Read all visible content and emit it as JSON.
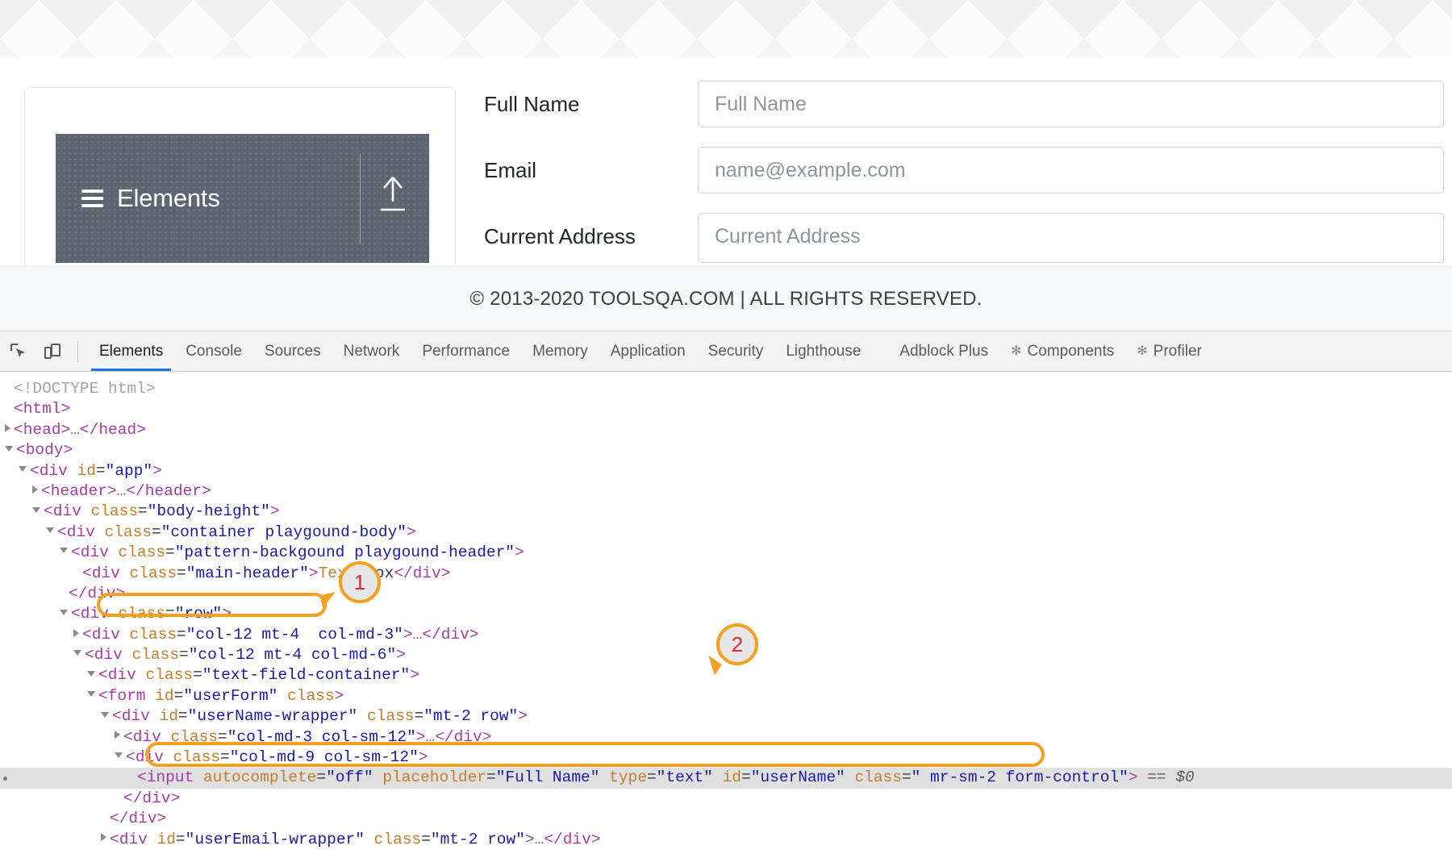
{
  "webpage": {
    "accordion": {
      "title": "Elements",
      "menu_icon": "hamburger-icon",
      "collapse_icon": "arrow-up-icon"
    },
    "form": {
      "fields": [
        {
          "label": "Full Name",
          "placeholder": "Full Name"
        },
        {
          "label": "Email",
          "placeholder": "name@example.com"
        },
        {
          "label": "Current Address",
          "placeholder": "Current Address"
        }
      ]
    },
    "footer": {
      "copyright": "© 2013-2020 TOOLSQA.COM | ALL RIGHTS RESERVED."
    }
  },
  "devtools": {
    "toolbar": {
      "inspect_icon": "inspect-element-icon",
      "device_icon": "device-toolbar-icon"
    },
    "tabs": [
      {
        "label": "Elements",
        "active": true,
        "icon": ""
      },
      {
        "label": "Console",
        "active": false,
        "icon": ""
      },
      {
        "label": "Sources",
        "active": false,
        "icon": ""
      },
      {
        "label": "Network",
        "active": false,
        "icon": ""
      },
      {
        "label": "Performance",
        "active": false,
        "icon": ""
      },
      {
        "label": "Memory",
        "active": false,
        "icon": ""
      },
      {
        "label": "Application",
        "active": false,
        "icon": ""
      },
      {
        "label": "Security",
        "active": false,
        "icon": ""
      },
      {
        "label": "Lighthouse",
        "active": false,
        "icon": ""
      },
      {
        "label": "Adblock Plus",
        "active": false,
        "icon": ""
      },
      {
        "label": "Components",
        "active": false,
        "icon": "react-icon"
      },
      {
        "label": "Profiler",
        "active": false,
        "icon": "react-icon"
      }
    ],
    "dom_lines": [
      {
        "indent": 0,
        "twisty": "none",
        "text": "<!DOCTYPE html>",
        "kind": "doctype"
      },
      {
        "indent": 0,
        "twisty": "none",
        "text": "<html>",
        "kind": "tag"
      },
      {
        "indent": 0,
        "twisty": "closed",
        "text": "<head>…</head>",
        "kind": "tag"
      },
      {
        "indent": 0,
        "twisty": "open",
        "text": "<body>",
        "kind": "tag"
      },
      {
        "indent": 1,
        "twisty": "open",
        "text": "<div id=\"app\">",
        "kind": "mixed"
      },
      {
        "indent": 2,
        "twisty": "closed",
        "text": "<header>…</header>",
        "kind": "tag"
      },
      {
        "indent": 2,
        "twisty": "open",
        "text": "<div class=\"body-height\">",
        "kind": "mixed"
      },
      {
        "indent": 3,
        "twisty": "open",
        "text": "<div class=\"container playgound-body\">",
        "kind": "mixed"
      },
      {
        "indent": 4,
        "twisty": "open",
        "text": "<div class=\"pattern-backgound playgound-header\">",
        "kind": "mixed"
      },
      {
        "indent": 5,
        "twisty": "none",
        "text": "<div class=\"main-header\">Text Box</div>",
        "kind": "mixed"
      },
      {
        "indent": 4,
        "twisty": "none",
        "text": "</div>",
        "kind": "tag"
      },
      {
        "indent": 4,
        "twisty": "open",
        "text": "<div class=\"row\">",
        "kind": "mixed"
      },
      {
        "indent": 5,
        "twisty": "closed",
        "text": "<div class=\"col-12 mt-4  col-md-3\">…</div>",
        "kind": "mixed"
      },
      {
        "indent": 5,
        "twisty": "open",
        "text": "<div class=\"col-12 mt-4 col-md-6\">",
        "kind": "mixed"
      },
      {
        "indent": 6,
        "twisty": "open",
        "text": "<div class=\"text-field-container\">",
        "kind": "mixed"
      },
      {
        "indent": 6,
        "twisty": "open",
        "text": "<form id=\"userForm\" class>",
        "kind": "mixed",
        "highlight": 1
      },
      {
        "indent": 7,
        "twisty": "open",
        "text": "<div id=\"userName-wrapper\" class=\"mt-2 row\">",
        "kind": "mixed"
      },
      {
        "indent": 8,
        "twisty": "closed",
        "text": "<div class=\"col-md-3 col-sm-12\">…</div>",
        "kind": "mixed"
      },
      {
        "indent": 8,
        "twisty": "open",
        "text": "<div class=\"col-md-9 col-sm-12\">",
        "kind": "mixed"
      },
      {
        "indent": 9,
        "twisty": "none",
        "text": "<input autocomplete=\"off\" placeholder=\"Full Name\" type=\"text\" id=\"userName\" class=\" mr-sm-2 form-control\"> == $0",
        "kind": "mixed",
        "selected": true,
        "highlight": 2
      },
      {
        "indent": 8,
        "twisty": "none",
        "text": "</div>",
        "kind": "tag"
      },
      {
        "indent": 7,
        "twisty": "none",
        "text": "</div>",
        "kind": "tag"
      },
      {
        "indent": 7,
        "twisty": "closed",
        "text": "<div id=\"userEmail-wrapper\" class=\"mt-2 row\">…</div>",
        "kind": "mixed"
      }
    ],
    "annotations": [
      {
        "number": "1",
        "target": "form-userForm-line"
      },
      {
        "number": "2",
        "target": "input-userName-line"
      }
    ]
  },
  "colors": {
    "accent_orange": "#f5a01e",
    "badge_number": "#e8262c",
    "tab_active": "#1a73e8",
    "accordion_bg": "#5c6670",
    "tag_purple": "#a33ca3",
    "attr_orange": "#c47d2b",
    "value_blue": "#1a1aa6"
  }
}
